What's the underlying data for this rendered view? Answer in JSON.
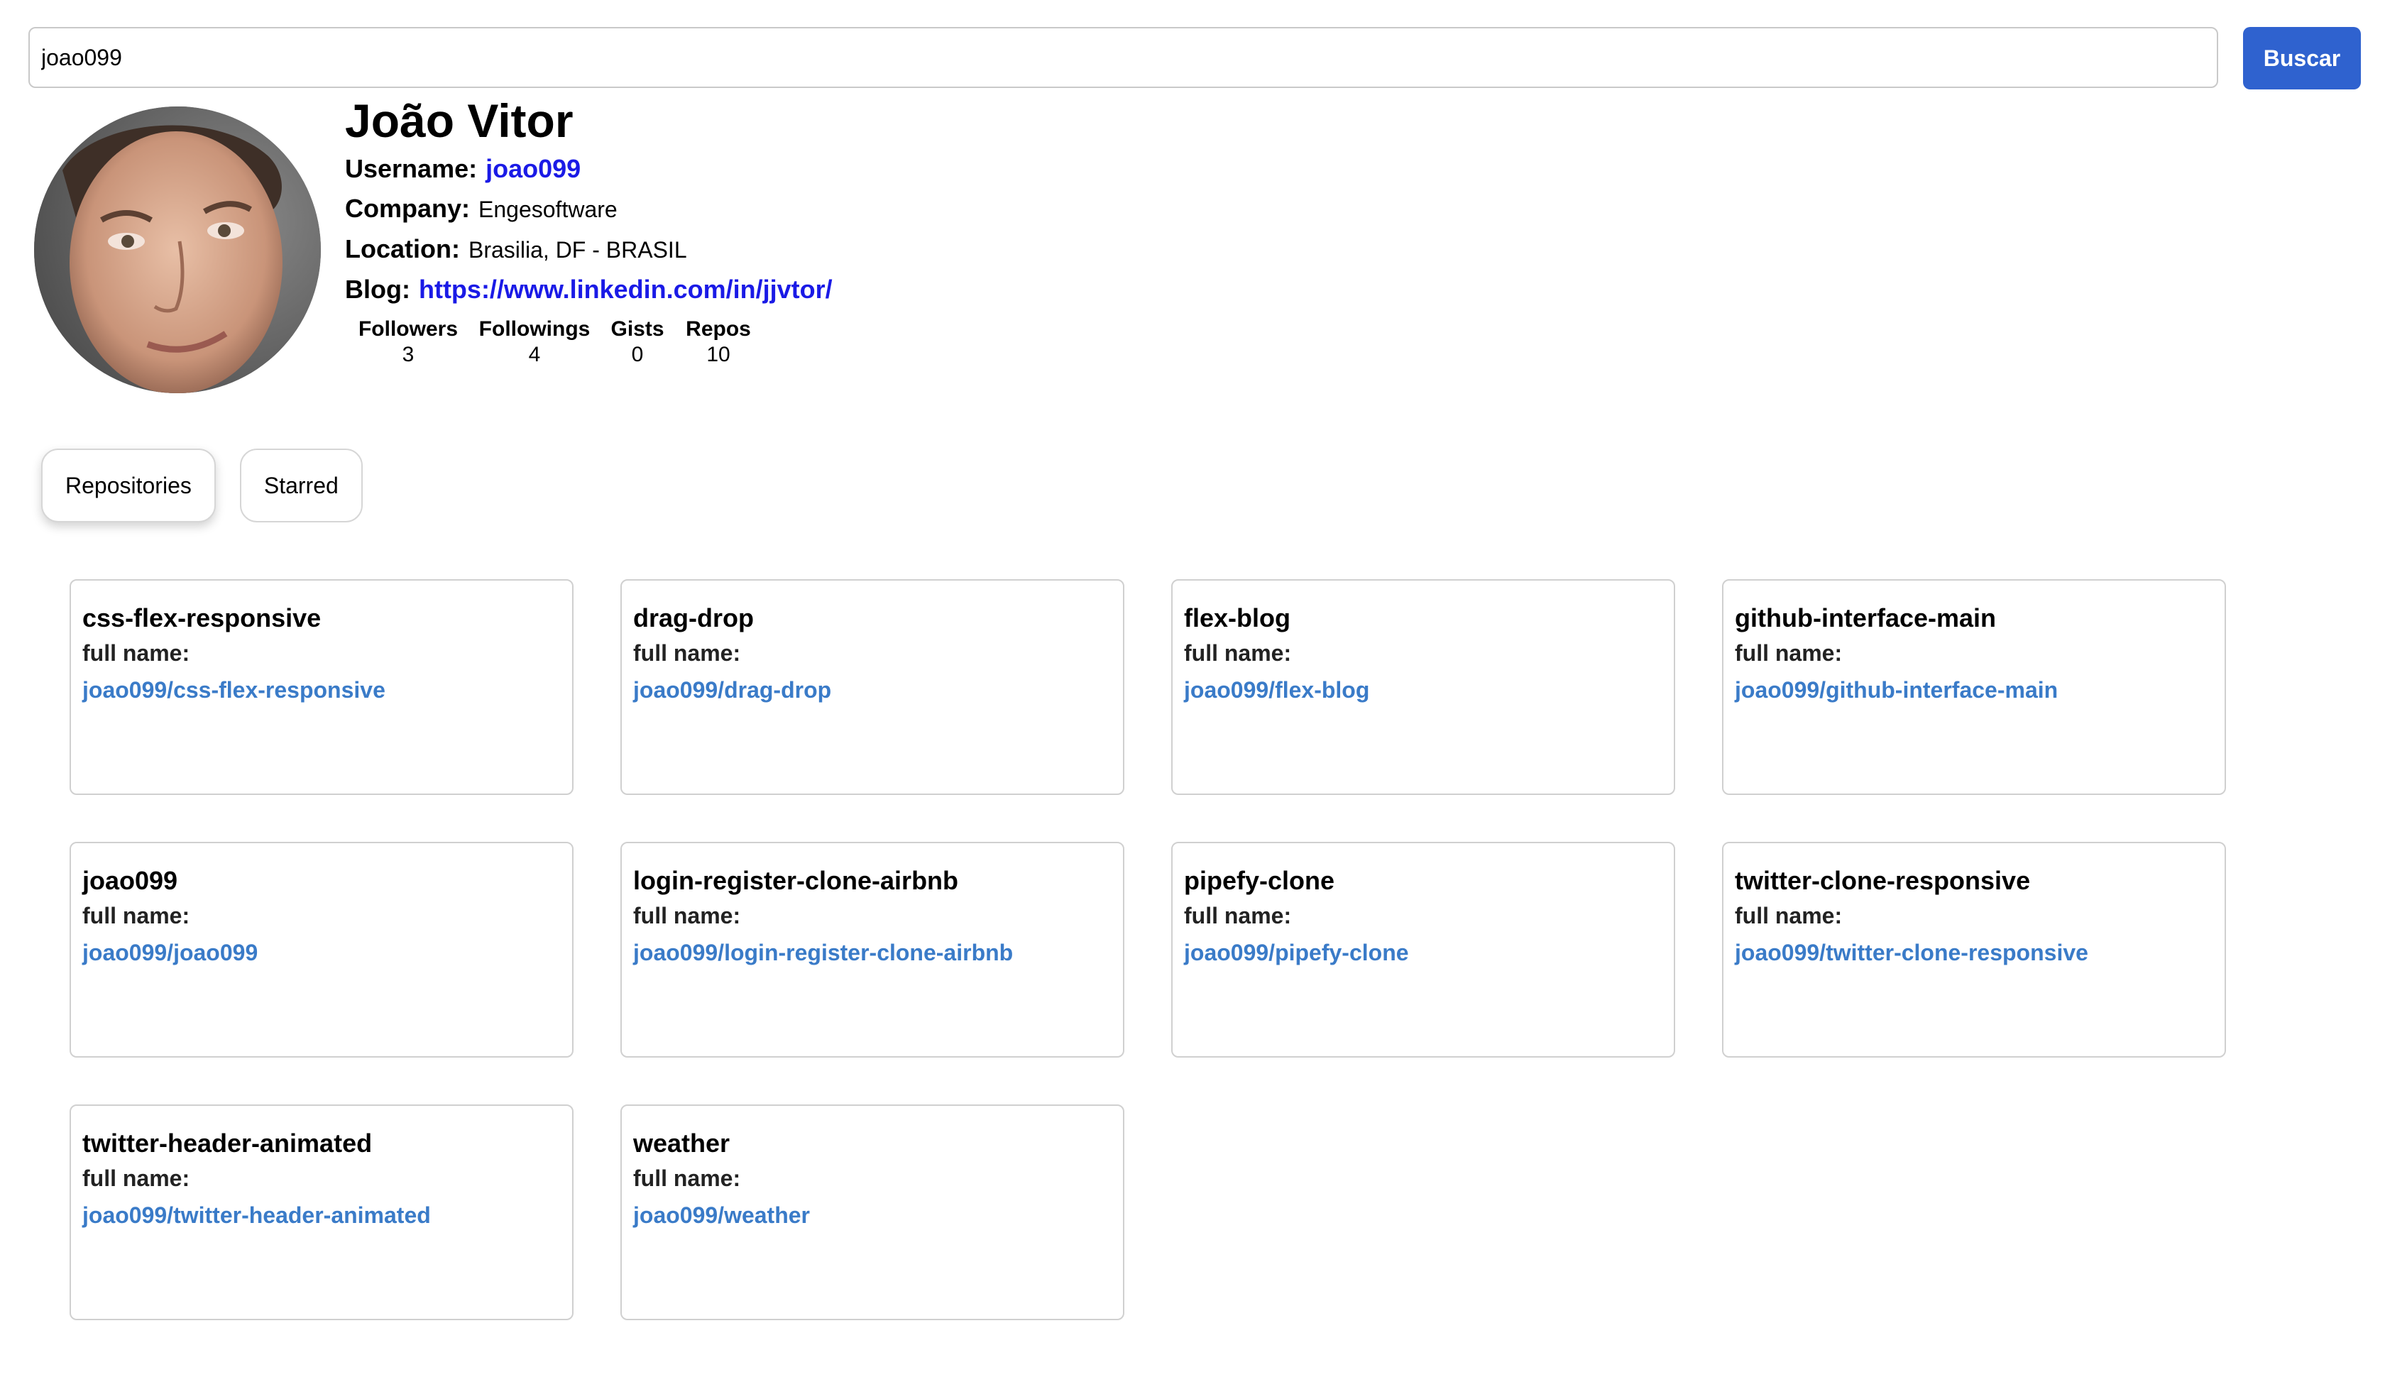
{
  "search": {
    "value": "joao099",
    "button_label": "Buscar"
  },
  "profile": {
    "name": "João Vitor",
    "username_label": "Username:",
    "username": "joao099",
    "company_label": "Company:",
    "company": "Engesoftware",
    "location_label": "Location:",
    "location": "Brasilia, DF - BRASIL",
    "blog_label": "Blog:",
    "blog": "https://www.linkedin.com/in/jjvtor/"
  },
  "stats": [
    {
      "label": "Followers",
      "value": "3"
    },
    {
      "label": "Followings",
      "value": "4"
    },
    {
      "label": "Gists",
      "value": "0"
    },
    {
      "label": "Repos",
      "value": "10"
    }
  ],
  "tabs": [
    {
      "label": "Repositories",
      "active": true
    },
    {
      "label": "Starred",
      "active": false
    }
  ],
  "repos": [
    {
      "name": "css-flex-responsive",
      "full_name_label": "full name:",
      "full_name": "joao099/css-flex-responsive"
    },
    {
      "name": "drag-drop",
      "full_name_label": "full name:",
      "full_name": "joao099/drag-drop"
    },
    {
      "name": "flex-blog",
      "full_name_label": "full name:",
      "full_name": "joao099/flex-blog"
    },
    {
      "name": "github-interface-main",
      "full_name_label": "full name:",
      "full_name": "joao099/github-interface-main"
    },
    {
      "name": "joao099",
      "full_name_label": "full name:",
      "full_name": "joao099/joao099"
    },
    {
      "name": "login-register-clone-airbnb",
      "full_name_label": "full name:",
      "full_name": "joao099/login-register-clone-airbnb"
    },
    {
      "name": "pipefy-clone",
      "full_name_label": "full name:",
      "full_name": "joao099/pipefy-clone"
    },
    {
      "name": "twitter-clone-responsive",
      "full_name_label": "full name:",
      "full_name": "joao099/twitter-clone-responsive"
    },
    {
      "name": "twitter-header-animated",
      "full_name_label": "full name:",
      "full_name": "joao099/twitter-header-animated"
    },
    {
      "name": "weather",
      "full_name_label": "full name:",
      "full_name": "joao099/weather"
    }
  ],
  "colors": {
    "accent": "#2f62cf",
    "profile_link": "#1a1ae6",
    "repo_link": "#3a7bc8"
  }
}
